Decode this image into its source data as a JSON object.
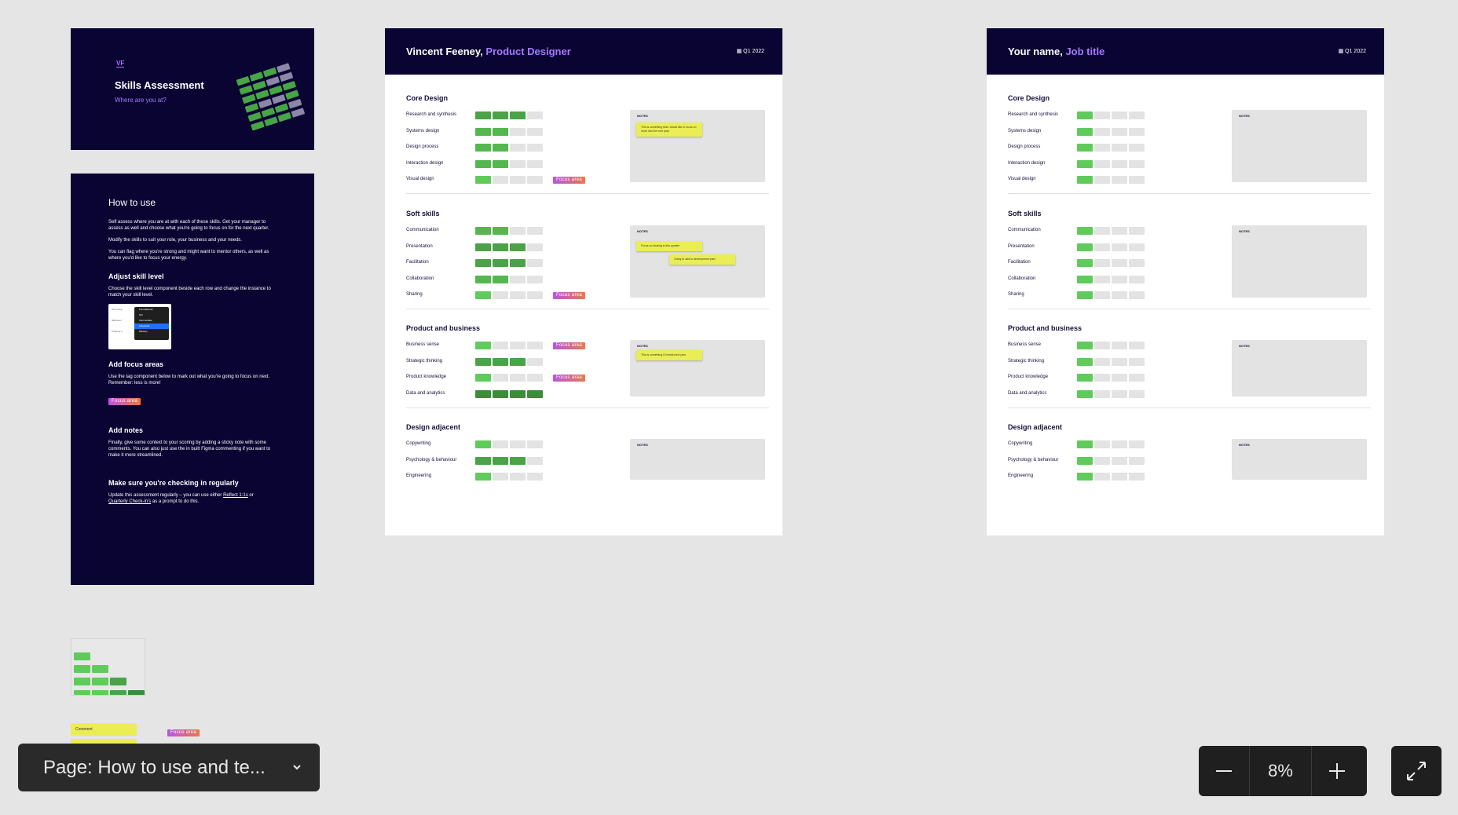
{
  "cover": {
    "logo": "VF",
    "title": "Skills Assessment",
    "subtitle": "Where are you at?"
  },
  "howto": {
    "title": "How to use",
    "intro": [
      "Self assess where you are at with each of these skills. Get your manager to assess as well and choose what you're going to focus on for the next quarter.",
      "Modify the skills to suit your role, your business and your needs.",
      "You can flag where you're strong and might want to mentor others, as well as where you'd like to focus your energy."
    ],
    "adjust_title": "Adjust skill level",
    "adjust_text": "Choose the skill level component beside each row and change the instance to match your skill level.",
    "mock_rows": [
      "Che comp",
      "Skill level",
      "Property 1"
    ],
    "mock_menu": [
      "Foundational",
      "N/A",
      "Intermediate",
      "Advanced",
      "Mastery"
    ],
    "focus_title": "Add focus areas",
    "focus_text": "Use the tag component below to mark out what you're going to focus on next. Remember: less is more!",
    "notes_title": "Add notes",
    "notes_text": "Finally, give some context to your scoring by adding a sticky note with some comments. You can also just use the in built Figma commenting if you want to make it more streamlined.",
    "regular_title": "Make sure you're checking in regularly",
    "regular_text_1": "Update this assessment regularly – you can use either ",
    "regular_link_1": "Reflect 1:1s",
    "regular_text_2": " or ",
    "regular_link_2": "Quarterly Check-in's",
    "regular_text_3": " as a prompt to do this."
  },
  "focus_label": "Focus area",
  "notes_label": "NOTES",
  "card1": {
    "name": "Vincent Feeney, ",
    "role": "Product Designer",
    "date": "Q1 2022"
  },
  "card2": {
    "name": "Your name, ",
    "role": "Job title",
    "date": "Q1 2022"
  },
  "sections": [
    {
      "title": "Core Design",
      "skills": [
        {
          "label": "Research and synthesis",
          "level1": 3,
          "level2": 1,
          "focus": false
        },
        {
          "label": "Systems design",
          "level1": 2,
          "level2": 1,
          "focus": false
        },
        {
          "label": "Design process",
          "level1": 2,
          "level2": 1,
          "focus": false
        },
        {
          "label": "Interaction design",
          "level1": 2,
          "level2": 1,
          "focus": false
        },
        {
          "label": "Visual design",
          "level1": 1,
          "level2": 1,
          "focus": true
        }
      ]
    },
    {
      "title": "Soft skills",
      "skills": [
        {
          "label": "Communication",
          "level1": 2,
          "level2": 1,
          "focus": false
        },
        {
          "label": "Presentation",
          "level1": 3,
          "level2": 1,
          "focus": false
        },
        {
          "label": "Facilitation",
          "level1": 3,
          "level2": 1,
          "focus": false
        },
        {
          "label": "Collaboration",
          "level1": 2,
          "level2": 1,
          "focus": false
        },
        {
          "label": "Sharing",
          "level1": 1,
          "level2": 1,
          "focus": true
        }
      ]
    },
    {
      "title": "Product and business",
      "skills": [
        {
          "label": "Business sense",
          "level1": 1,
          "level2": 1,
          "focus": true
        },
        {
          "label": "Strategic thinking",
          "level1": 3,
          "level2": 1,
          "focus": false
        },
        {
          "label": "Product knowledge",
          "level1": 1,
          "level2": 1,
          "focus": true
        },
        {
          "label": "Data and analytics",
          "level1": 4,
          "level2": 1,
          "focus": false
        }
      ]
    },
    {
      "title": "Design adjacent",
      "skills": [
        {
          "label": "Copywriting",
          "level1": 1,
          "level2": 1,
          "focus": false
        },
        {
          "label": "Psychology & behaviour",
          "level1": 3,
          "level2": 1,
          "focus": false
        },
        {
          "label": "Engineering",
          "level1": 1,
          "level2": 1,
          "focus": false
        }
      ]
    }
  ],
  "stickies": {
    "core": "This is something that I would like to focus on more into the next year",
    "soft_1": "Focus on sharing in this quarter",
    "soft_2": "Going to add to development plan",
    "product": "This is something I'll revisit next year"
  },
  "components": {
    "sticky_label": "Comment"
  },
  "page_selector": {
    "label": "Page: How to use and te..."
  },
  "zoom": {
    "value": "8%"
  },
  "colors": {
    "navy": "#0a0433",
    "purple": "#a679ff",
    "green": "#5fcb5b",
    "empty": "#e3e3e3",
    "sticky": "#eaee54"
  }
}
